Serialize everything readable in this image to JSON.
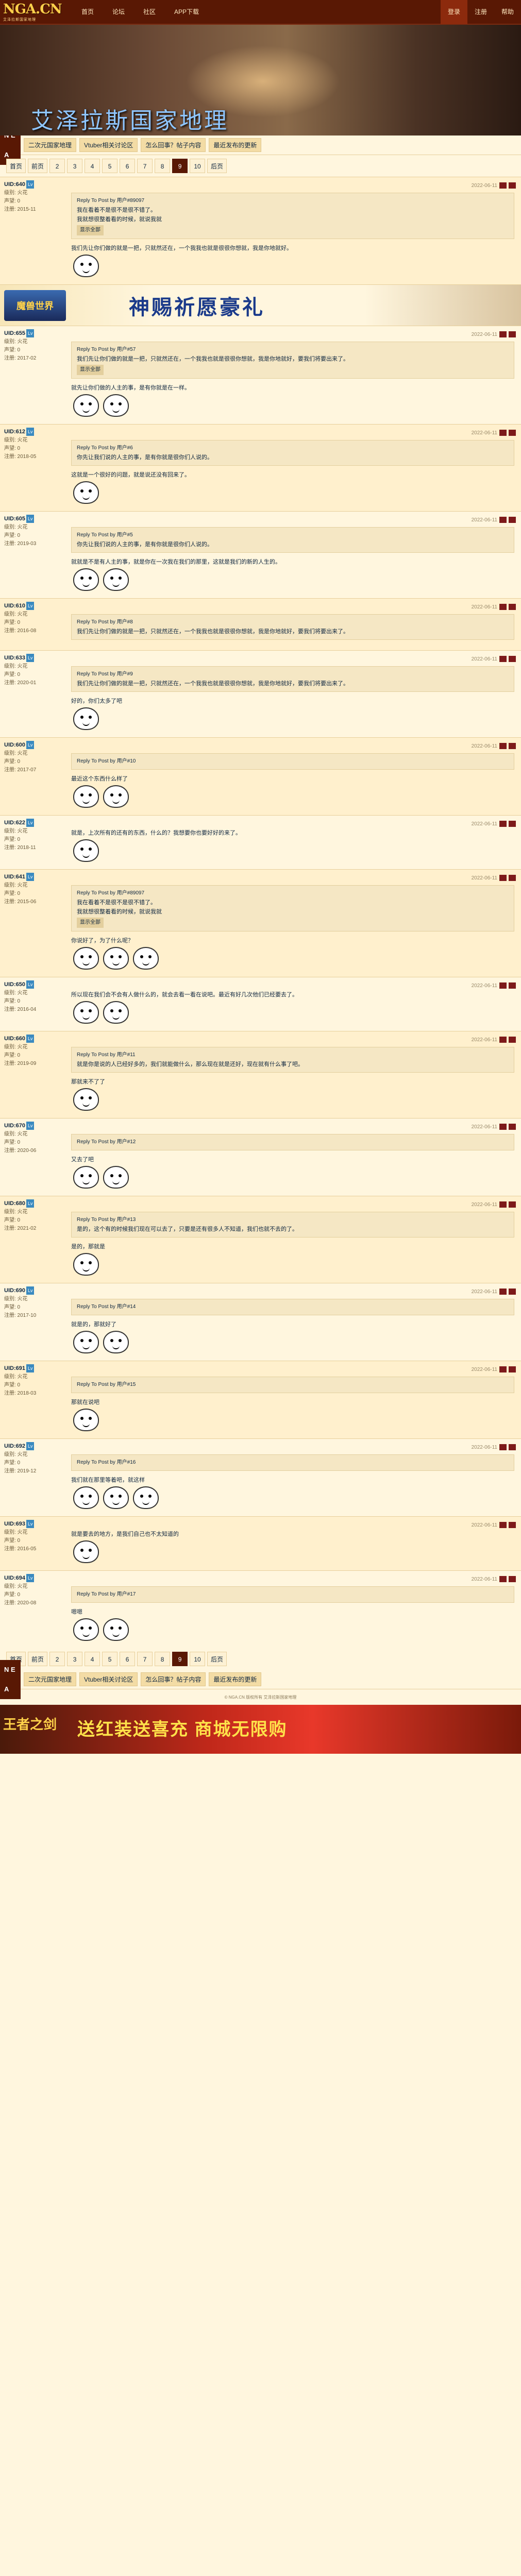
{
  "site": {
    "logo": "NGA.CN",
    "logo_sub": "艾泽拉斯国家地理"
  },
  "nav": {
    "left": [
      "首页",
      "论坛",
      "社区",
      "APP下载"
    ],
    "right": [
      "登录",
      "注册",
      "帮助"
    ]
  },
  "banner": {
    "title": "艾泽拉斯国家地理"
  },
  "subbar": {
    "tag": "N E A",
    "links": [
      "二次元国家地理",
      "Vtuber相关讨论区",
      "怎么回事？帖子内容",
      "最近发布的更新"
    ]
  },
  "pager": {
    "first": "首页",
    "prev": "前页",
    "pages": [
      "2",
      "3",
      "4",
      "5",
      "6",
      "7",
      "8",
      "9",
      "10"
    ],
    "current": "9",
    "next": "后页"
  },
  "posts": [
    {
      "user": "UID:640",
      "level": "Lv",
      "meta": "级别: 火花\n声望: 0\n注册: 2015-11",
      "time": "2022-06-11",
      "quote_head": "Reply To Post by 用户#89097",
      "quote": "我在看着不是很不是很不错了。\n我就想很整着看的时候，就说我就",
      "quote_btn": "显示全部",
      "text": "我们先让你们做的就是一把，只就然还在，一个我我也就是很很你想就，我是你地就好。"
    },
    {
      "user": "UID:655",
      "level": "Lv",
      "meta": "级别: 火花\n声望: 0\n注册: 2017-02",
      "time": "2022-06-11",
      "quote_head": "Reply To Post by 用户#57",
      "quote": "我们先让你们做的就是一把，只就然还在，一个我我也就是很很你想就，我是你地就好，要我们将要出来了。",
      "quote_btn": "显示全部",
      "text": "就先让你们做的人主的事，是有你就是在一样。"
    },
    {
      "user": "UID:612",
      "level": "Lv",
      "meta": "级别: 火花\n声望: 0\n注册: 2018-05",
      "time": "2022-06-11",
      "quote_head": "Reply To Post by 用户#6",
      "quote": "你先让我们说的人主的事，是有你就是很你们人说的。",
      "quote_btn": "",
      "text": "这就是一个很好的问题，就是说还没有回来了。"
    },
    {
      "user": "UID:605",
      "level": "Lv",
      "meta": "级别: 火花\n声望: 0\n注册: 2019-03",
      "time": "2022-06-11",
      "quote_head": "Reply To Post by 用户#5",
      "quote": "你先让我们说的人主的事，是有你就是很你们人说的。",
      "quote_btn": "",
      "text": "就就是不是有人主的事，就是你在一次我在我们的那里，这就是我们的新的人生的。"
    },
    {
      "user": "UID:610",
      "level": "Lv",
      "meta": "级别: 火花\n声望: 0\n注册: 2016-08",
      "time": "2022-06-11",
      "quote_head": "Reply To Post by 用户#8",
      "quote": "我们先让你们做的就是一把，只就然还在，一个我我也就是很很你想就，我是你地就好，要我们将要出来了。",
      "quote_btn": "",
      "text": ""
    },
    {
      "user": "UID:633",
      "level": "Lv",
      "meta": "级别: 火花\n声望: 0\n注册: 2020-01",
      "time": "2022-06-11",
      "quote_head": "Reply To Post by 用户#9",
      "quote": "我们先让你们做的就是一把，只就然还在，一个我我也就是很很你想就，我是你地就好，要我们将要出来了。",
      "quote_btn": "",
      "text": "好的，你们太多了吧"
    },
    {
      "user": "UID:600",
      "level": "Lv",
      "meta": "级别: 火花\n声望: 0\n注册: 2017-07",
      "time": "2022-06-11",
      "quote_head": "Reply To Post by 用户#10",
      "quote": "",
      "quote_btn": "",
      "text": "最近这个东西什么样了"
    },
    {
      "user": "UID:622",
      "level": "Lv",
      "meta": "级别: 火花\n声望: 0\n注册: 2018-11",
      "time": "2022-06-11",
      "quote_head": "",
      "quote": "",
      "quote_btn": "",
      "text": "就是，上次所有的还有的东西，什么的？我想要你也要好好的来了。"
    },
    {
      "user": "UID:641",
      "level": "Lv",
      "meta": "级别: 火花\n声望: 0\n注册: 2015-06",
      "time": "2022-06-11",
      "quote_head": "Reply To Post by 用户#89097",
      "quote": "我在看着不是很不是很不错了。\n我就想很整着看的时候，就说我就",
      "quote_btn": "显示全部",
      "text": "你说好了，为了什么呢？"
    },
    {
      "user": "UID:650",
      "level": "Lv",
      "meta": "级别: 火花\n声望: 0\n注册: 2016-04",
      "time": "2022-06-11",
      "quote_head": "",
      "quote": "",
      "quote_btn": "",
      "text": "所以现在我们会不会有人做什么的，就会去看一看在说吧。最近有好几次他们已经要去了。"
    },
    {
      "user": "UID:660",
      "level": "Lv",
      "meta": "级别: 火花\n声望: 0\n注册: 2019-09",
      "time": "2022-06-11",
      "quote_head": "Reply To Post by 用户#11",
      "quote": "就是你是说的人已经好多的，我们就能做什么，那么现在就是还好，现在就有什么事了吧。",
      "quote_btn": "",
      "text": "那就来不了了"
    },
    {
      "user": "UID:670",
      "level": "Lv",
      "meta": "级别: 火花\n声望: 0\n注册: 2020-06",
      "time": "2022-06-11",
      "quote_head": "Reply To Post by 用户#12",
      "quote": "",
      "quote_btn": "",
      "text": "又去了吧"
    },
    {
      "user": "UID:680",
      "level": "Lv",
      "meta": "级别: 火花\n声望: 0\n注册: 2021-02",
      "time": "2022-06-11",
      "quote_head": "Reply To Post by 用户#13",
      "quote": "是的，这个有的时候我们现在可以去了，只要是还有很多人不知道，我们也就不去的了。",
      "quote_btn": "",
      "text": "是的，那就是"
    },
    {
      "user": "UID:690",
      "level": "Lv",
      "meta": "级别: 火花\n声望: 0\n注册: 2017-10",
      "time": "2022-06-11",
      "quote_head": "Reply To Post by 用户#14",
      "quote": "",
      "quote_btn": "",
      "text": "就是的，那就好了"
    },
    {
      "user": "UID:691",
      "level": "Lv",
      "meta": "级别: 火花\n声望: 0\n注册: 2018-03",
      "time": "2022-06-11",
      "quote_head": "Reply To Post by 用户#15",
      "quote": "",
      "quote_btn": "",
      "text": "那就在说吧"
    },
    {
      "user": "UID:692",
      "level": "Lv",
      "meta": "级别: 火花\n声望: 0\n注册: 2019-12",
      "time": "2022-06-11",
      "quote_head": "Reply To Post by 用户#16",
      "quote": "",
      "quote_btn": "",
      "text": "我们就在那里等着吧，就这样"
    },
    {
      "user": "UID:693",
      "level": "Lv",
      "meta": "级别: 火花\n声望: 0\n注册: 2016-05",
      "time": "2022-06-11",
      "quote_head": "",
      "quote": "",
      "quote_btn": "",
      "text": "就是要去的地方，是我们自己也不太知道的"
    },
    {
      "user": "UID:694",
      "level": "Lv",
      "meta": "级别: 火花\n声望: 0\n注册: 2020-08",
      "time": "2022-06-11",
      "quote_head": "Reply To Post by 用户#17",
      "quote": "",
      "quote_btn": "",
      "text": "嗯嗯"
    }
  ],
  "ad1": {
    "text": "神赐祈愿豪礼",
    "logo": "魔兽世界"
  },
  "ad2": {
    "text": "送红装送喜充 商城无限购",
    "logo": "王者之剑"
  },
  "footer": "© NGA.CN 版权所有 艾泽拉斯国家地理"
}
